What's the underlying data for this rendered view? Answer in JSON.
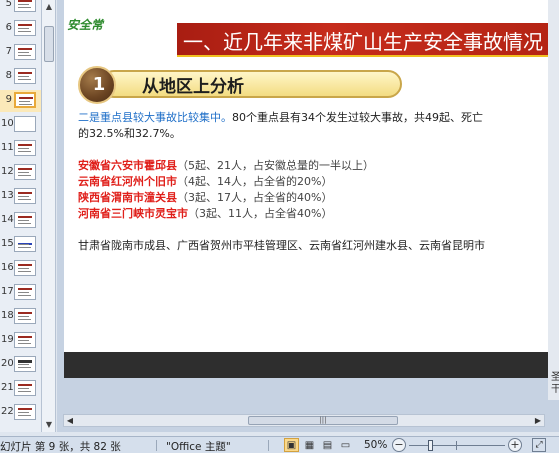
{
  "thumbnails": [
    {
      "num": "5",
      "style": "normal"
    },
    {
      "num": "6",
      "style": "normal"
    },
    {
      "num": "7",
      "style": "normal"
    },
    {
      "num": "8",
      "style": "normal"
    },
    {
      "num": "9",
      "style": "selected"
    },
    {
      "num": "10",
      "style": "blank"
    },
    {
      "num": "11",
      "style": "normal"
    },
    {
      "num": "12",
      "style": "normal"
    },
    {
      "num": "13",
      "style": "normal"
    },
    {
      "num": "14",
      "style": "normal"
    },
    {
      "num": "15",
      "style": "blue"
    },
    {
      "num": "16",
      "style": "normal"
    },
    {
      "num": "17",
      "style": "normal"
    },
    {
      "num": "18",
      "style": "normal"
    },
    {
      "num": "19",
      "style": "normal"
    },
    {
      "num": "20",
      "style": "dark"
    },
    {
      "num": "21",
      "style": "normal"
    },
    {
      "num": "22",
      "style": "normal"
    }
  ],
  "slide": {
    "logo": "安全常",
    "banner": "一、近几年来非煤矿山生产安全事故情况",
    "section_number": "1",
    "section_title": "从地区上分析",
    "para1_blue": "二是重点县较大事故比较集中。",
    "para1_rest": "80个重点县有34个发生过较大事故，共49起、死亡",
    "para1_line2": "的32.5%和32.7%。",
    "items": [
      {
        "name": "安徽省六安市霍邱县",
        "detail": "（5起、21人，占安徽总量的一半以上）"
      },
      {
        "name": "云南省红河州个旧市",
        "detail": "（4起、14人，占全省的20%）"
      },
      {
        "name": "陕西省渭南市潼关县",
        "detail": "（3起、17人，占全省的40%）"
      },
      {
        "name": "河南省三门峡市灵宝市",
        "detail": "（3起、11人，占全省40%）"
      }
    ],
    "para_last": "甘肃省陇南市成县、广西省贺州市平桂管理区、云南省红河州建水县、云南省昆明市"
  },
  "status": {
    "slide_info": "幻灯片 第 9 张，共 82 张",
    "theme": "\"Office 主题\"",
    "zoom": "50%"
  },
  "icons": {
    "scroll_up": "▲",
    "scroll_down": "▼",
    "scroll_left": "◀",
    "scroll_right": "▶",
    "hscroll_grip": "|||",
    "side_glyph_1": "圣",
    "side_glyph_2": "干",
    "view_normal": "▣",
    "view_sorter": "▦",
    "view_reading": "▤",
    "view_slideshow": "▭",
    "spell_check": "⌧",
    "zoom_minus": "−",
    "zoom_plus": "+",
    "fit": "⤢"
  }
}
